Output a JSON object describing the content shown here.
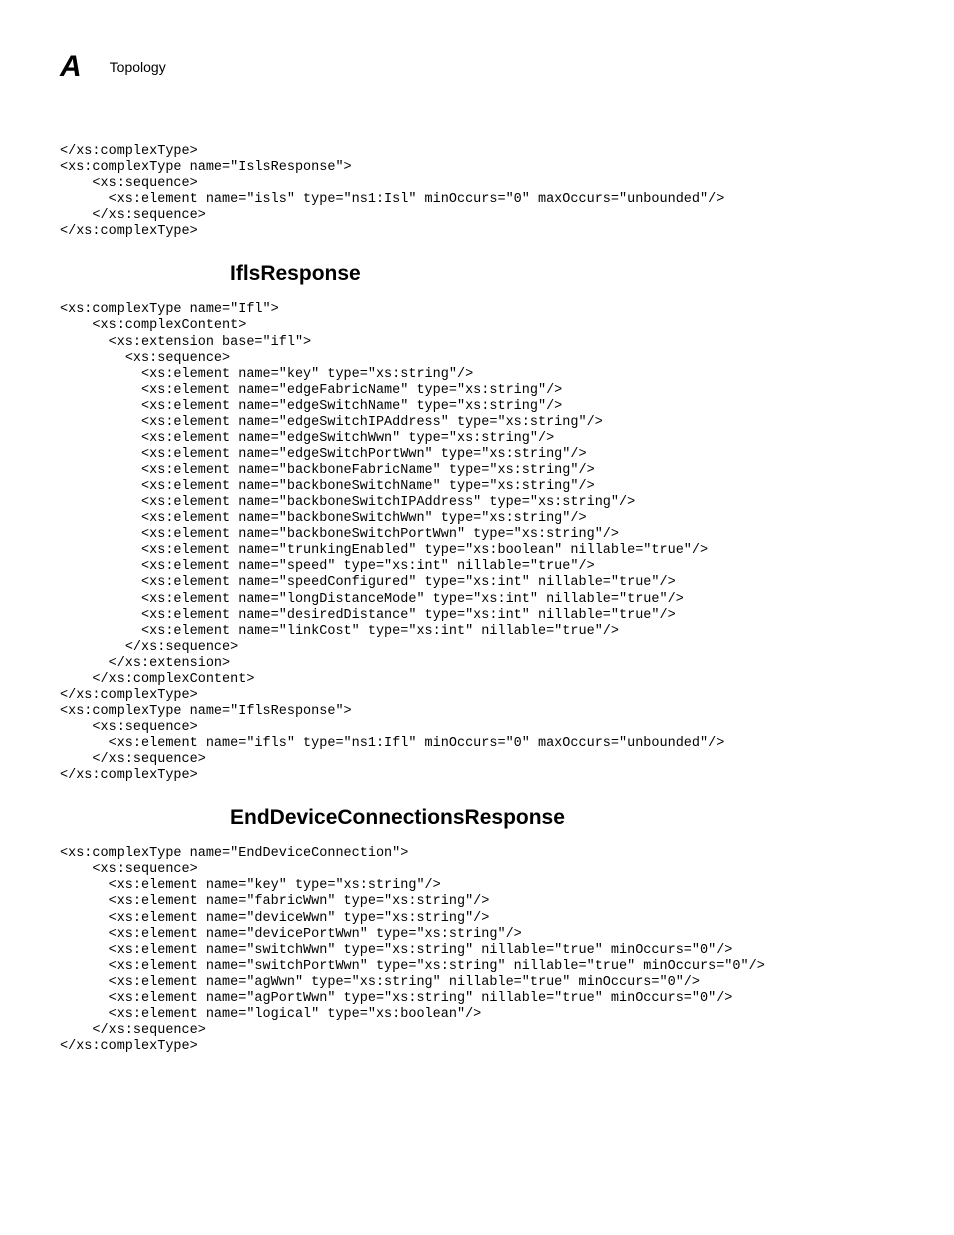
{
  "header": {
    "appendix": "A",
    "section": "Topology"
  },
  "block1": "</xs:complexType>",
  "block2": "<xs:complexType name=\"IslsResponse\">\n    <xs:sequence>\n      <xs:element name=\"isls\" type=\"ns1:Isl\" minOccurs=\"0\" maxOccurs=\"unbounded\"/>\n    </xs:sequence>\n</xs:complexType>",
  "heading1": "IflsResponse",
  "block3": "<xs:complexType name=\"Ifl\">\n    <xs:complexContent>\n      <xs:extension base=\"ifl\">\n        <xs:sequence>\n          <xs:element name=\"key\" type=\"xs:string\"/>\n          <xs:element name=\"edgeFabricName\" type=\"xs:string\"/>\n          <xs:element name=\"edgeSwitchName\" type=\"xs:string\"/>\n          <xs:element name=\"edgeSwitchIPAddress\" type=\"xs:string\"/>\n          <xs:element name=\"edgeSwitchWwn\" type=\"xs:string\"/>\n          <xs:element name=\"edgeSwitchPortWwn\" type=\"xs:string\"/>\n          <xs:element name=\"backboneFabricName\" type=\"xs:string\"/>\n          <xs:element name=\"backboneSwitchName\" type=\"xs:string\"/>\n          <xs:element name=\"backboneSwitchIPAddress\" type=\"xs:string\"/>\n          <xs:element name=\"backboneSwitchWwn\" type=\"xs:string\"/>\n          <xs:element name=\"backboneSwitchPortWwn\" type=\"xs:string\"/>\n          <xs:element name=\"trunkingEnabled\" type=\"xs:boolean\" nillable=\"true\"/>\n          <xs:element name=\"speed\" type=\"xs:int\" nillable=\"true\"/>\n          <xs:element name=\"speedConfigured\" type=\"xs:int\" nillable=\"true\"/>\n          <xs:element name=\"longDistanceMode\" type=\"xs:int\" nillable=\"true\"/>\n          <xs:element name=\"desiredDistance\" type=\"xs:int\" nillable=\"true\"/>\n          <xs:element name=\"linkCost\" type=\"xs:int\" nillable=\"true\"/>\n        </xs:sequence>\n      </xs:extension>\n    </xs:complexContent>\n</xs:complexType>",
  "block4": "<xs:complexType name=\"IflsResponse\">\n    <xs:sequence>\n      <xs:element name=\"ifls\" type=\"ns1:Ifl\" minOccurs=\"0\" maxOccurs=\"unbounded\"/>\n    </xs:sequence>\n</xs:complexType>",
  "heading2": "EndDeviceConnectionsResponse",
  "block5": "<xs:complexType name=\"EndDeviceConnection\">\n    <xs:sequence>\n      <xs:element name=\"key\" type=\"xs:string\"/>\n      <xs:element name=\"fabricWwn\" type=\"xs:string\"/>\n      <xs:element name=\"deviceWwn\" type=\"xs:string\"/>\n      <xs:element name=\"devicePortWwn\" type=\"xs:string\"/>\n      <xs:element name=\"switchWwn\" type=\"xs:string\" nillable=\"true\" minOccurs=\"0\"/>\n      <xs:element name=\"switchPortWwn\" type=\"xs:string\" nillable=\"true\" minOccurs=\"0\"/>\n      <xs:element name=\"agWwn\" type=\"xs:string\" nillable=\"true\" minOccurs=\"0\"/>\n      <xs:element name=\"agPortWwn\" type=\"xs:string\" nillable=\"true\" minOccurs=\"0\"/>\n      <xs:element name=\"logical\" type=\"xs:boolean\"/>\n    </xs:sequence>\n</xs:complexType>"
}
